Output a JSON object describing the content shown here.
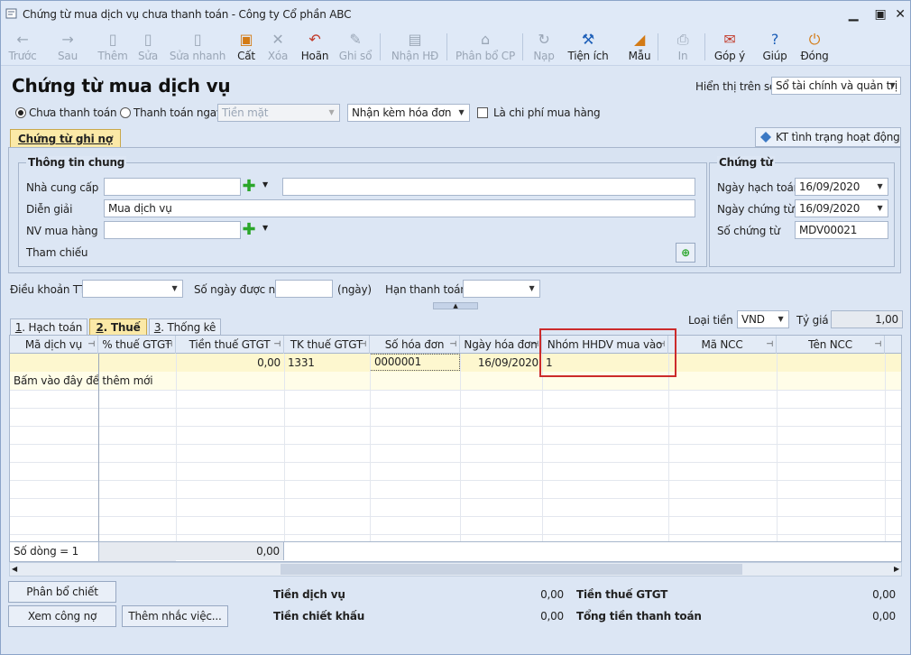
{
  "window": {
    "title": "Chứng từ mua dịch vụ chưa thanh toán - Công ty Cổ phần ABC"
  },
  "toolbar": {
    "items": [
      {
        "label": "Trước",
        "icon": "←"
      },
      {
        "label": "Sau",
        "icon": "→"
      },
      {
        "label": "Thêm",
        "icon": "▯"
      },
      {
        "label": "Sửa",
        "icon": "▯"
      },
      {
        "label": "Sửa nhanh",
        "icon": "▯"
      },
      {
        "label": "Cất",
        "icon": "▣"
      },
      {
        "label": "Xóa",
        "icon": "✕"
      },
      {
        "label": "Hoãn",
        "icon": "↶"
      },
      {
        "label": "Ghi sổ",
        "icon": "✎"
      },
      {
        "label": "Nhận HĐ",
        "icon": "▤"
      },
      {
        "label": "Phân bổ CP",
        "icon": "⌂"
      },
      {
        "label": "Nạp",
        "icon": "↻"
      },
      {
        "label": "Tiện ích",
        "icon": "⚒"
      },
      {
        "label": "Mẫu",
        "icon": "◢"
      },
      {
        "label": "In",
        "icon": "⎙"
      },
      {
        "label": "Góp ý",
        "icon": "✉"
      },
      {
        "label": "Giúp",
        "icon": "?"
      },
      {
        "label": "Đóng",
        "icon": "⏻"
      }
    ]
  },
  "header": {
    "title": "Chứng từ mua dịch vụ",
    "display_label": "Hiển thị trên sổ",
    "display_value": "Sổ tài chính và quản trị"
  },
  "options": {
    "unpaid": "Chưa thanh toán",
    "pay_now": "Thanh toán ngay",
    "method": "Tiền mặt",
    "invoice": "Nhận kèm hóa đơn",
    "is_cost": "Là chi phí mua hàng"
  },
  "tabs": {
    "main": "Chứng từ ghi nợ",
    "kt": "KT tình trạng hoạt động DN"
  },
  "general": {
    "title": "Thông tin chung",
    "supplier_label": "Nhà cung cấp",
    "supplier": "",
    "supplier_name": "",
    "desc_label": "Diễn giải",
    "desc": "Mua dịch vụ",
    "staff_label": "NV mua hàng",
    "staff": "",
    "ref_label": "Tham chiếu"
  },
  "voucher": {
    "title": "Chứng từ",
    "post_date_label": "Ngày hạch toán",
    "post_date": "16/09/2020",
    "doc_date_label": "Ngày chứng từ",
    "doc_date": "16/09/2020",
    "doc_no_label": "Số chứng từ",
    "doc_no": "MDV00021"
  },
  "terms": {
    "terms_label": "Điều khoản TT",
    "terms": "",
    "days_label": "Số ngày được nợ",
    "days": "",
    "days_unit": "(ngày)",
    "due_label": "Hạn thanh toán",
    "due": ""
  },
  "currency": {
    "label": "Loại tiền",
    "value": "VND",
    "rate_label": "Tỷ giá",
    "rate": "1,00"
  },
  "detail_tabs": [
    {
      "num": "1",
      "label": ". Hạch toán"
    },
    {
      "num": "2",
      "label": ". Thuế"
    },
    {
      "num": "3",
      "label": ". Thống kê"
    }
  ],
  "grid": {
    "columns": [
      "Mã dịch vụ",
      "% thuế GTGT",
      "Tiền thuế GTGT",
      "TK thuế GTGT",
      "Số hóa đơn",
      "Ngày hóa đơn",
      "Nhóm HHDV mua vào",
      "Mã NCC",
      "Tên NCC"
    ],
    "row": [
      "",
      "",
      "0,00",
      "1331",
      "0000001",
      "16/09/2020",
      "1",
      "",
      ""
    ],
    "add_hint": "Bấm vào đây để thêm mới",
    "row_count": "Số dòng = 1",
    "total_tax": "0,00"
  },
  "buttons": {
    "discount": "Phân bổ chiết khấu...",
    "debt": "Xem công nợ",
    "remind": "Thêm nhắc việc..."
  },
  "totals": {
    "service_label": "Tiền dịch vụ",
    "service": "0,00",
    "discount_label": "Tiền chiết khấu",
    "discount": "0,00",
    "vat_label": "Tiền thuế GTGT",
    "vat": "0,00",
    "total_label": "Tổng tiền thanh toán",
    "total": "0,00"
  },
  "colors": {
    "highlight": "#cc2b2b",
    "row_selected": "#fdf7cf"
  }
}
